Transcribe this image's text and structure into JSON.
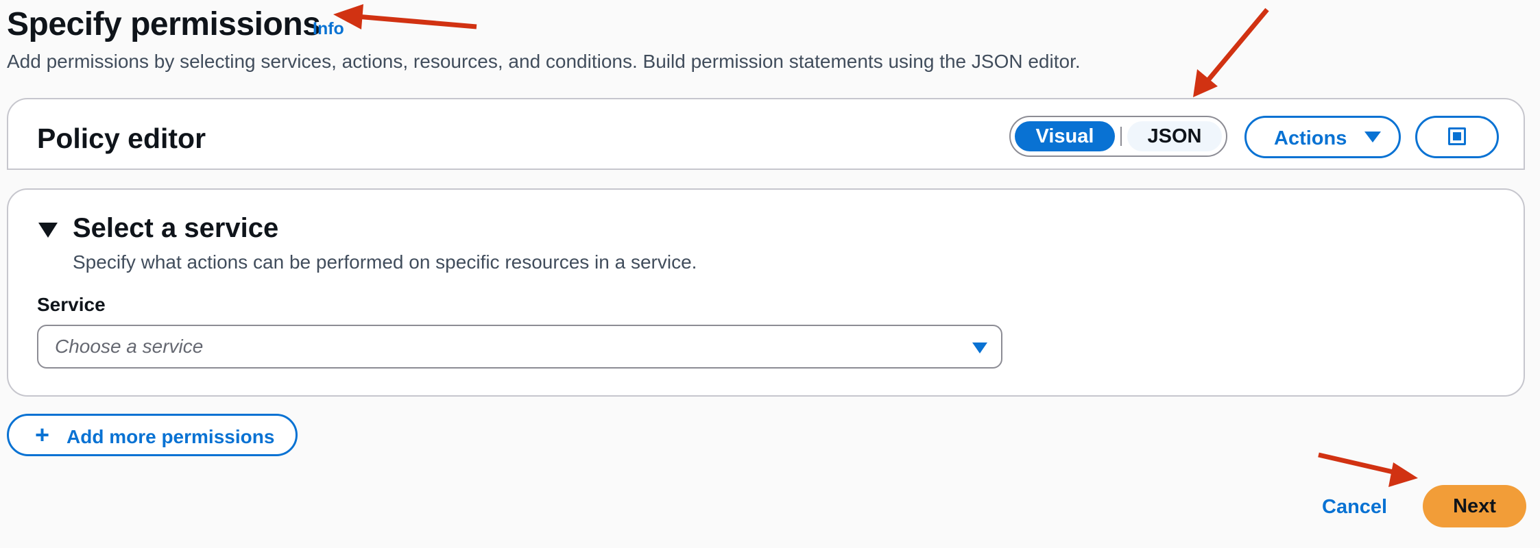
{
  "header": {
    "title": "Specify permissions",
    "info_link": "Info",
    "description": "Add permissions by selecting services, actions, resources, and conditions. Build permission statements using the JSON editor."
  },
  "policy_editor": {
    "title": "Policy editor",
    "modes": [
      {
        "label": "Visual",
        "selected": true
      },
      {
        "label": "JSON",
        "selected": false
      }
    ],
    "actions_label": "Actions",
    "fullscreen_icon": "fullscreen-icon"
  },
  "service_section": {
    "title": "Select a service",
    "description": "Specify what actions can be performed on specific resources in a service.",
    "service_label": "Service",
    "service_placeholder": "Choose a service"
  },
  "add_permissions_label": "Add more permissions",
  "footer": {
    "cancel_label": "Cancel",
    "next_label": "Next"
  },
  "colors": {
    "accent": "#0972d3",
    "primary_button": "#f29d38",
    "annotation_arrow": "#d13212"
  }
}
